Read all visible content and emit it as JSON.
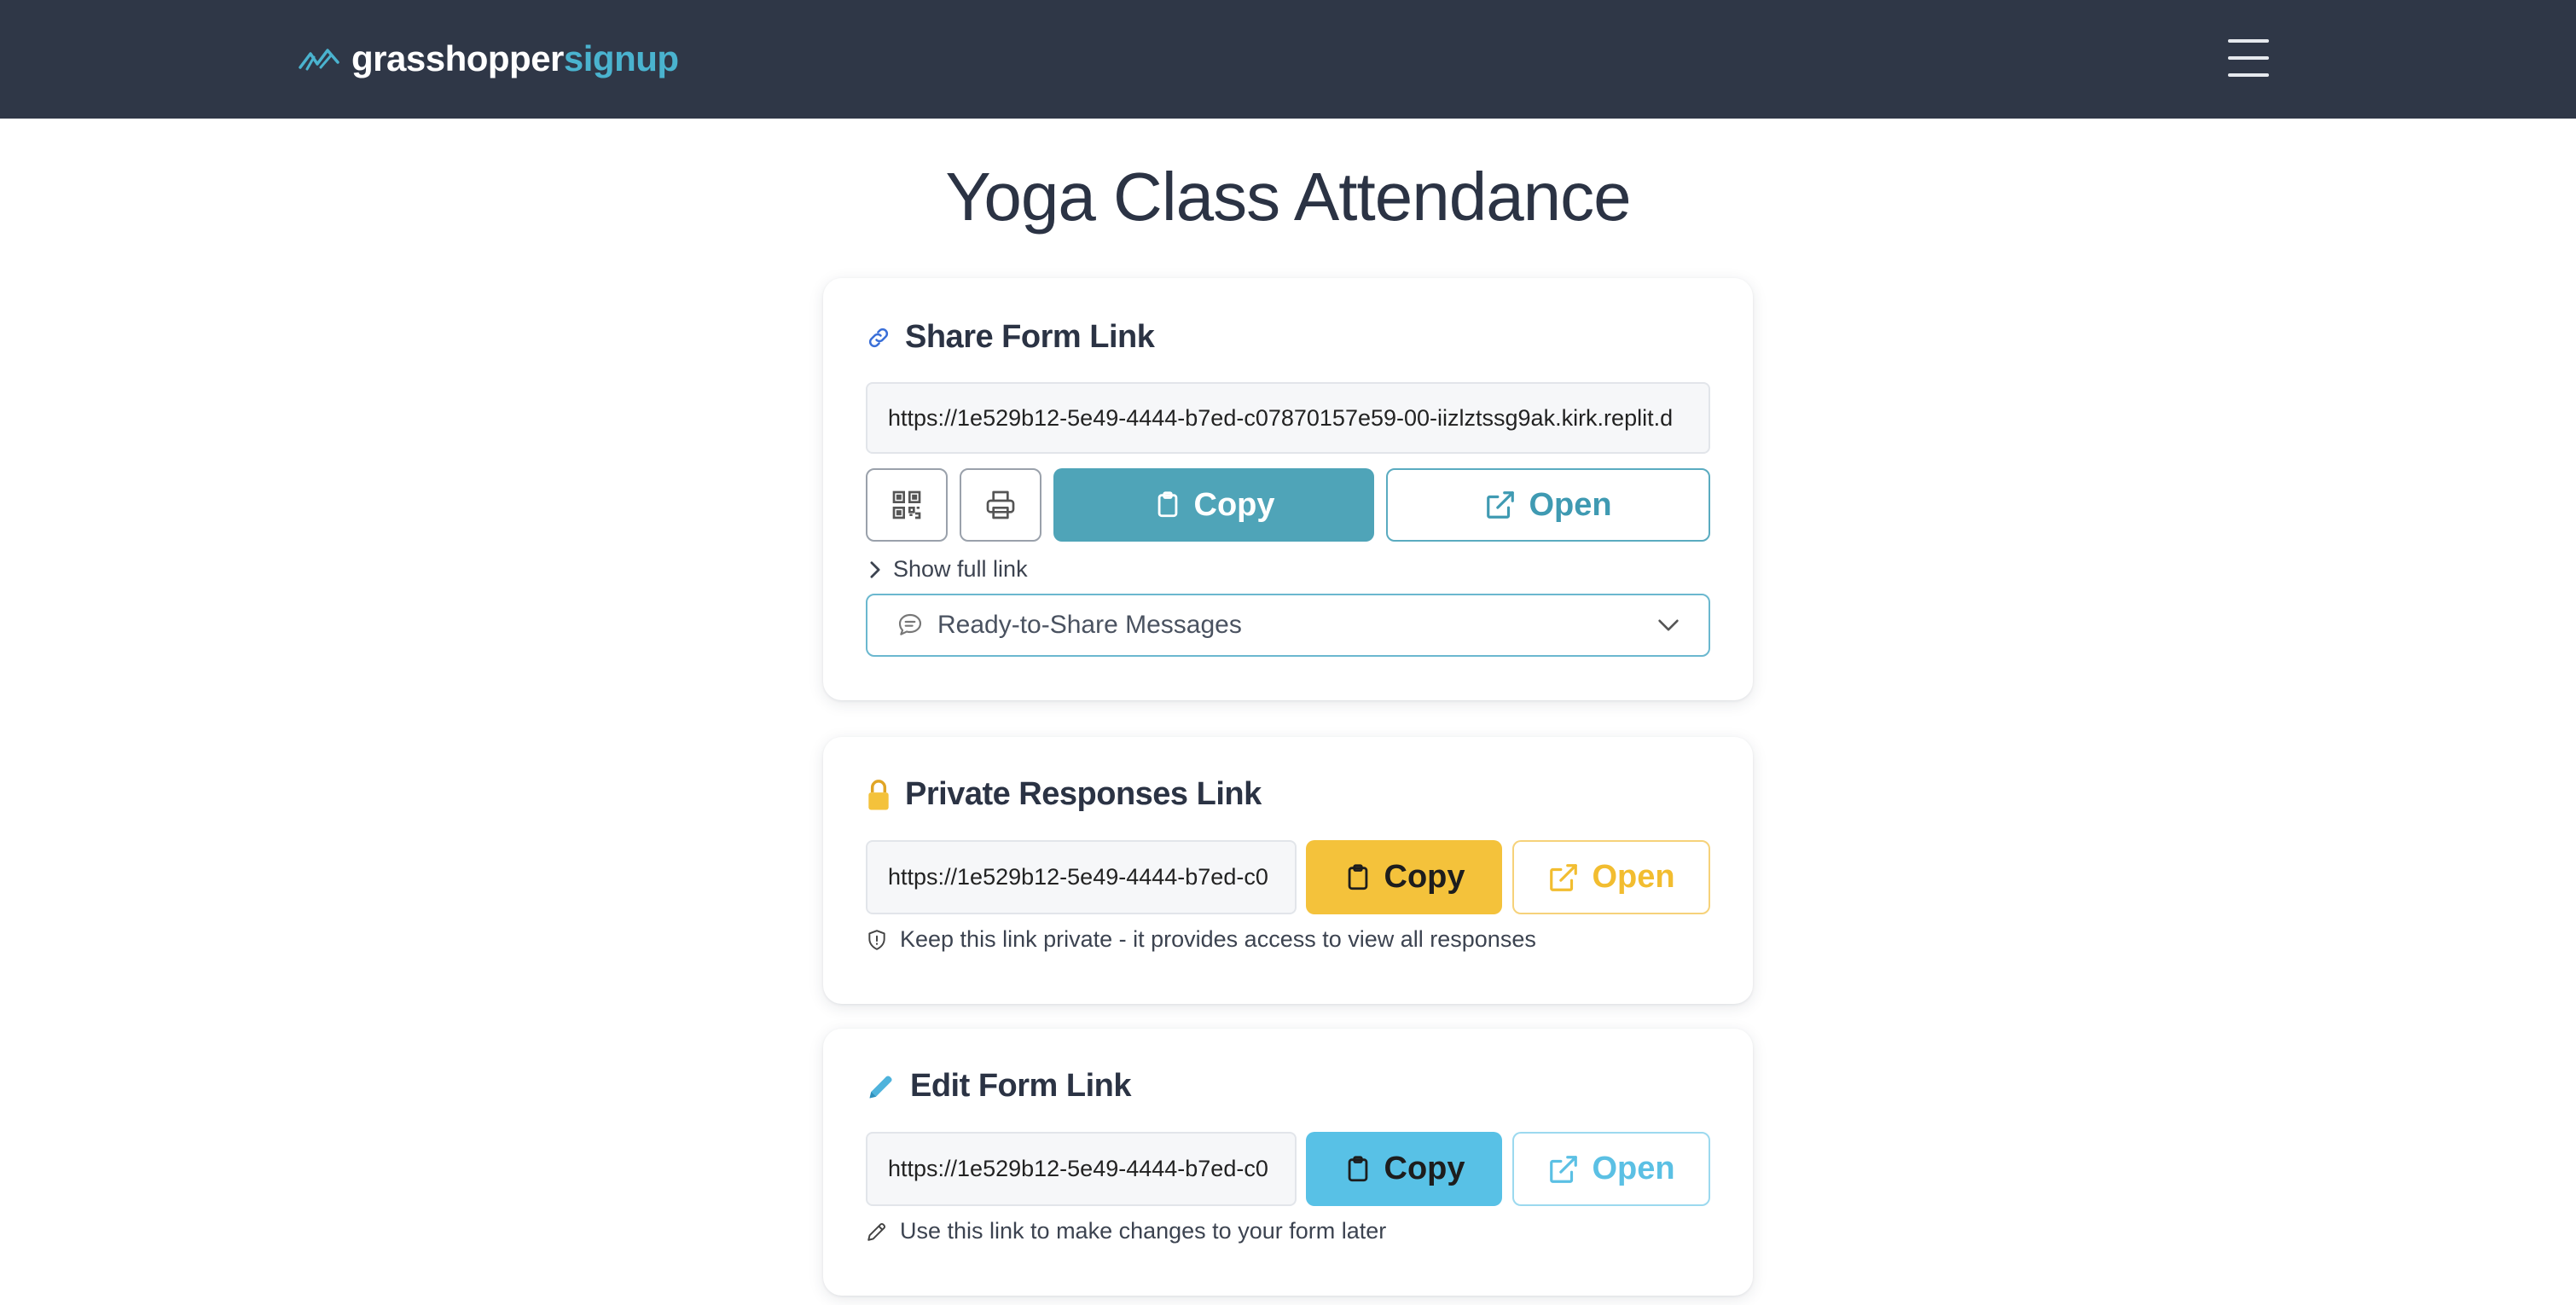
{
  "brand": {
    "name_part1": "grasshopper",
    "name_part2": "signup",
    "logo_icon": "grasshopper-logo-icon"
  },
  "navbar": {
    "menu_icon": "hamburger-menu-icon"
  },
  "page": {
    "title": "Yoga Class Attendance"
  },
  "share_card": {
    "title": "Share Form Link",
    "title_icon": "link-icon",
    "url": "https://1e529b12-5e49-4444-b7ed-c07870157e59-00-iizlztssg9ak.kirk.replit.d",
    "qr_icon": "qr-code-icon",
    "print_icon": "printer-icon",
    "copy_label": "Copy",
    "open_label": "Open",
    "show_full_link": "Show full link",
    "messages_dropdown": "Ready-to-Share Messages"
  },
  "private_card": {
    "title": "Private Responses Link",
    "title_icon": "lock-icon",
    "url": "https://1e529b12-5e49-4444-b7ed-c0",
    "copy_label": "Copy",
    "open_label": "Open",
    "note": "Keep this link private - it provides access to view all responses"
  },
  "edit_card": {
    "title": "Edit Form Link",
    "title_icon": "pencil-icon",
    "url": "https://1e529b12-5e49-4444-b7ed-c0",
    "copy_label": "Copy",
    "open_label": "Open",
    "note": "Use this link to make changes to your form later"
  },
  "colors": {
    "navbar": "#2f3747",
    "brand_accent": "#4ab3cf",
    "teal": "#4fa4b8",
    "yellow": "#f4c23b",
    "blue": "#58c1e6"
  }
}
